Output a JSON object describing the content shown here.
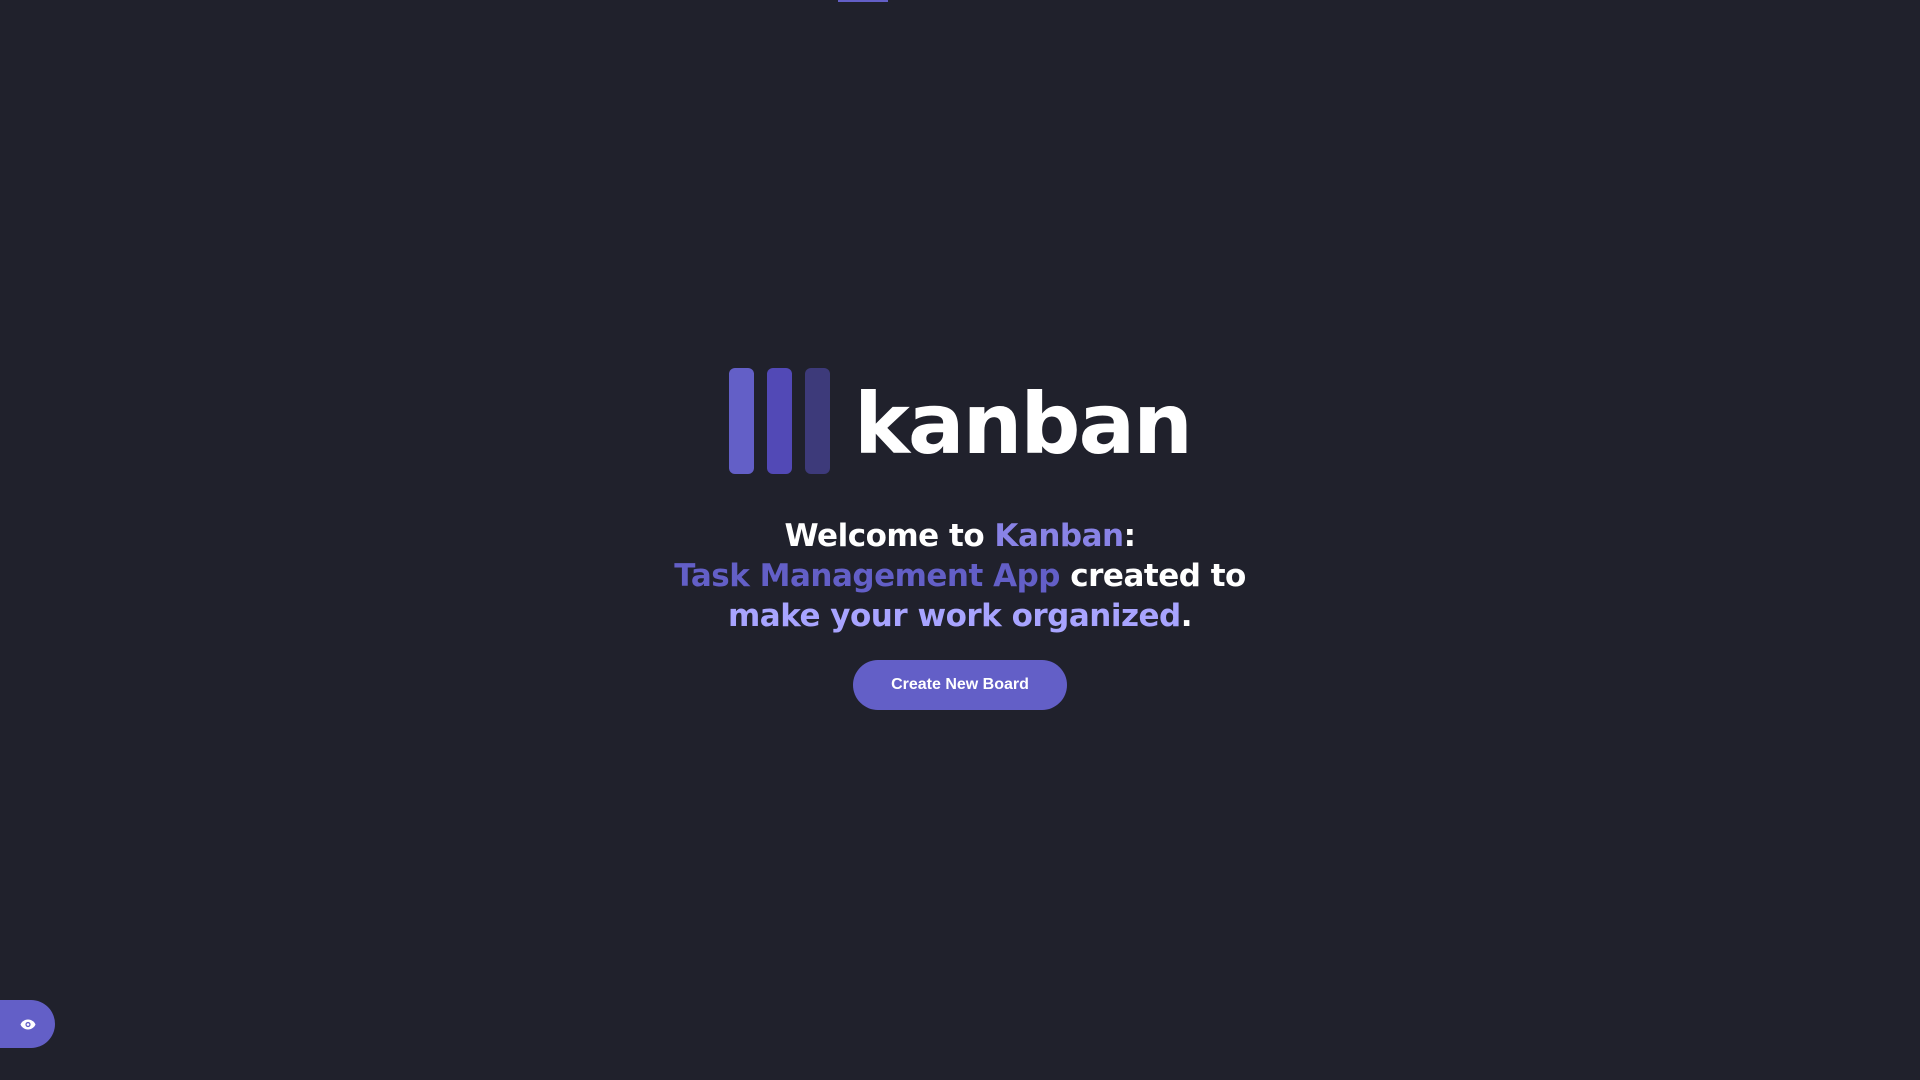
{
  "logo": {
    "text": "kanban",
    "bar_colors": [
      "#635fc7",
      "#5249b6",
      "#3d3a7a"
    ]
  },
  "welcome": {
    "part1": "Welcome to ",
    "part2": "Kanban",
    "part3": ":",
    "part4": "Task Management App",
    "part5": " created to",
    "part6": "make your work organized",
    "part7": "."
  },
  "actions": {
    "create_board_label": "Create New Board"
  },
  "sidebar_toggle": {
    "icon": "eye-icon"
  },
  "colors": {
    "background": "#20212c",
    "accent": "#635fc7",
    "accent_light": "#a8a4ff"
  }
}
